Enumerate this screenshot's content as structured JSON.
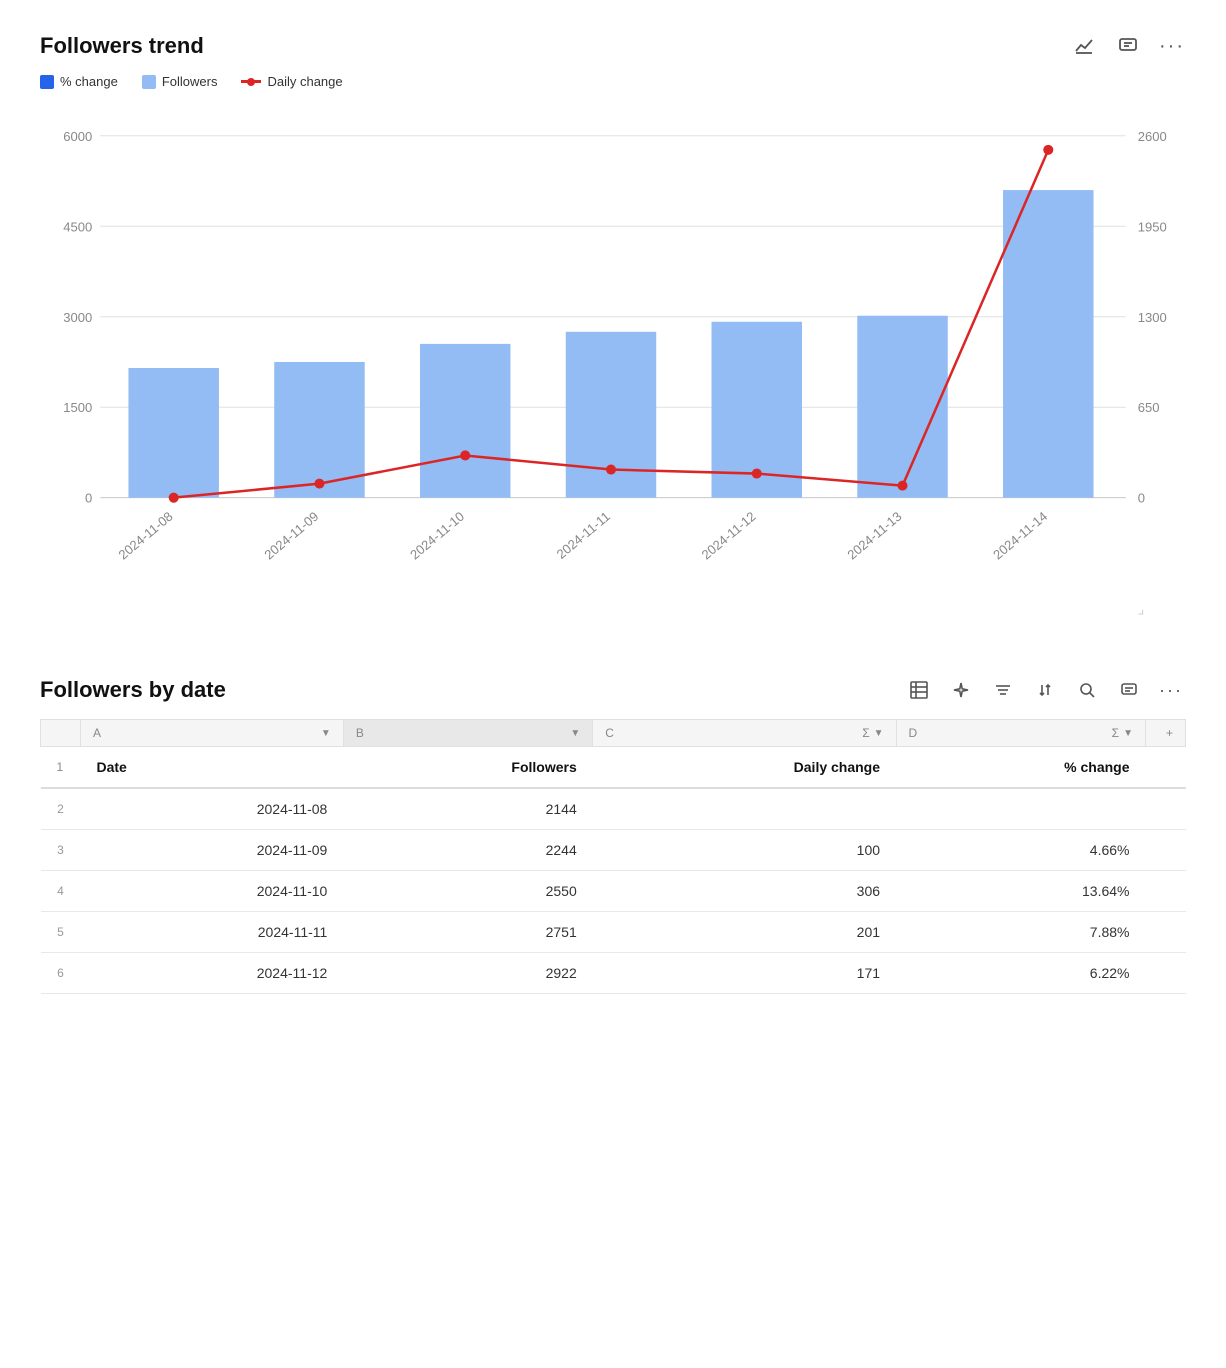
{
  "chart": {
    "title": "Followers trend",
    "icons": [
      "chart-icon",
      "comment-icon",
      "more-icon"
    ],
    "legend": [
      {
        "key": "pct_change",
        "label": "% change",
        "color": "dark-blue"
      },
      {
        "key": "followers",
        "label": "Followers",
        "color": "light-blue"
      },
      {
        "key": "daily_change",
        "label": "Daily change",
        "color": "red"
      }
    ],
    "leftAxis": {
      "values": [
        "6000",
        "4500",
        "3000",
        "1500",
        "0"
      ]
    },
    "rightAxis": {
      "values": [
        "2600",
        "1950",
        "1300",
        "650",
        "0"
      ]
    },
    "dates": [
      "2024-11-08",
      "2024-11-09",
      "2024-11-10",
      "2024-11-11",
      "2024-11-12",
      "2024-11-13",
      "2024-11-14"
    ],
    "followers_values": [
      2144,
      2244,
      2550,
      2751,
      2922,
      3012,
      5100
    ],
    "daily_change_values": [
      0,
      100,
      306,
      201,
      171,
      90,
      2500
    ]
  },
  "table": {
    "title": "Followers by date",
    "icons": [
      "table-icon",
      "sparkle-icon",
      "filter-icon",
      "sort-icon",
      "search-icon",
      "comment-icon",
      "more-icon"
    ],
    "columns": {
      "A": {
        "letter": "A",
        "label": "Date"
      },
      "B": {
        "letter": "B",
        "label": "Followers"
      },
      "C": {
        "letter": "C",
        "label": "Daily change"
      },
      "D": {
        "letter": "D",
        "label": "% change"
      }
    },
    "rows": [
      {
        "row_num": "1",
        "date": "Date",
        "followers": "Followers",
        "daily_change": "Daily change",
        "pct_change": "% change",
        "is_header": true
      },
      {
        "row_num": "2",
        "date": "2024-11-08",
        "followers": "2144",
        "daily_change": "",
        "pct_change": ""
      },
      {
        "row_num": "3",
        "date": "2024-11-09",
        "followers": "2244",
        "daily_change": "100",
        "pct_change": "4.66%"
      },
      {
        "row_num": "4",
        "date": "2024-11-10",
        "followers": "2550",
        "daily_change": "306",
        "pct_change": "13.64%"
      },
      {
        "row_num": "5",
        "date": "2024-11-11",
        "followers": "2751",
        "daily_change": "201",
        "pct_change": "7.88%"
      },
      {
        "row_num": "6",
        "date": "2024-11-12",
        "followers": "2922",
        "daily_change": "171",
        "pct_change": "6.22%"
      }
    ]
  }
}
